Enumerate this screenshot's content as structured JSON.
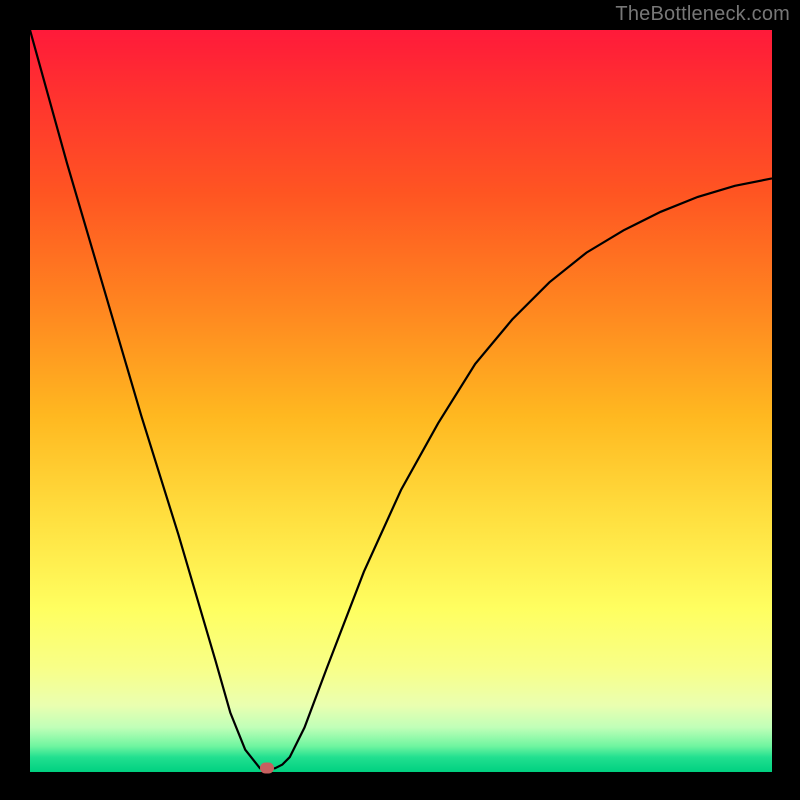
{
  "watermark": "TheBottleneck.com",
  "chart_data": {
    "type": "line",
    "title": "",
    "xlabel": "",
    "ylabel": "",
    "xlim": [
      0,
      100
    ],
    "ylim": [
      0,
      100
    ],
    "series": [
      {
        "name": "curve",
        "x": [
          0,
          5,
          10,
          15,
          20,
          25,
          27,
          29,
          31,
          33,
          34,
          35,
          37,
          40,
          45,
          50,
          55,
          60,
          65,
          70,
          75,
          80,
          85,
          90,
          95,
          100
        ],
        "values": [
          100,
          82,
          65,
          48,
          32,
          15,
          8,
          3,
          0.5,
          0.5,
          1,
          2,
          6,
          14,
          27,
          38,
          47,
          55,
          61,
          66,
          70,
          73,
          75.5,
          77.5,
          79,
          80
        ]
      }
    ],
    "marker": {
      "x": 32,
      "y": 0.5
    },
    "colors": {
      "gradient_top": "#ff1a3a",
      "gradient_mid": "#ffe040",
      "gradient_bottom": "#00d080",
      "curve": "#000000",
      "marker": "#c86060",
      "frame": "#000000"
    }
  }
}
